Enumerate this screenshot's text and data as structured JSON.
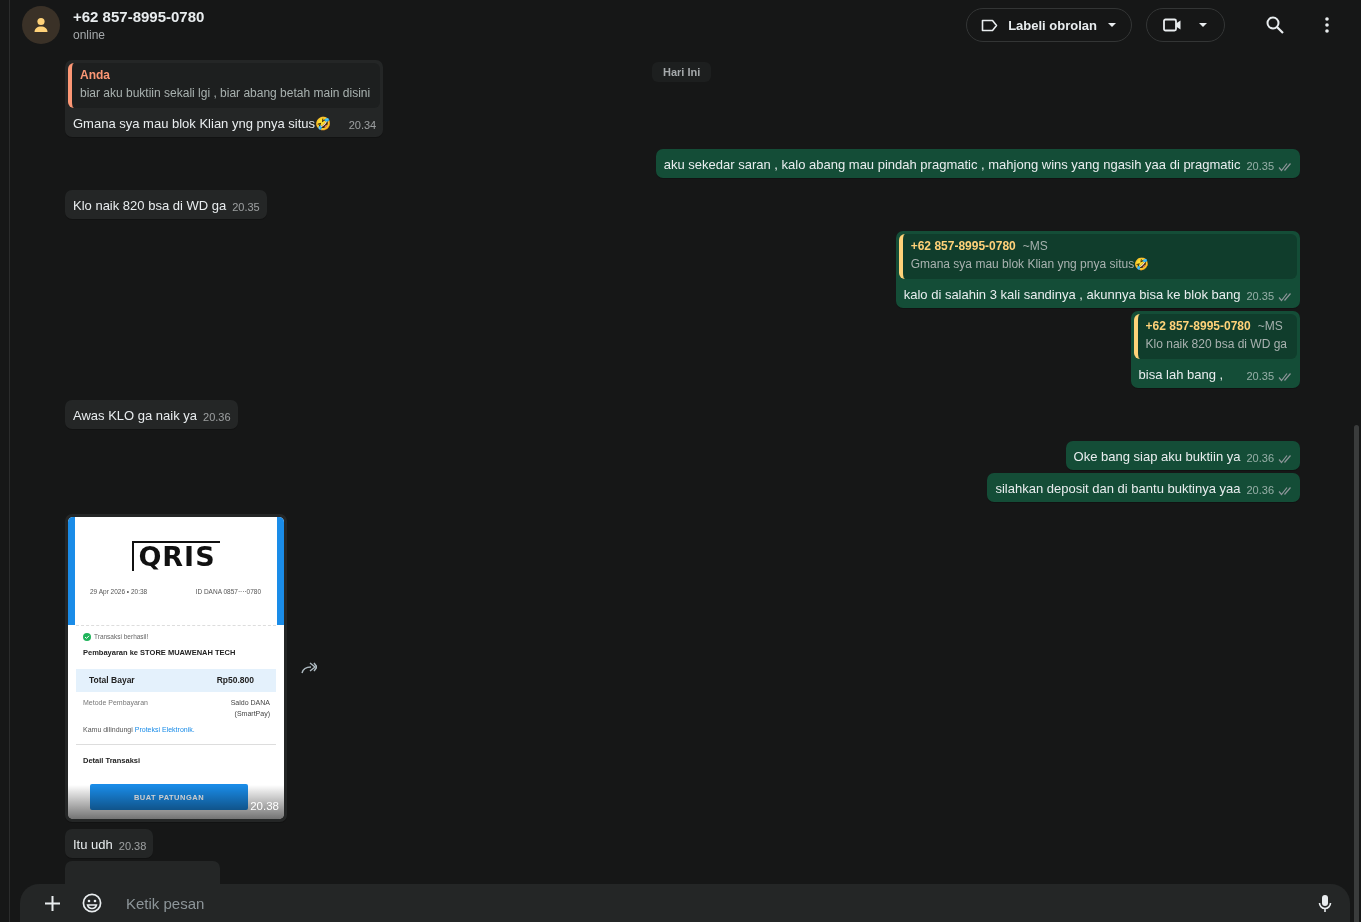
{
  "header": {
    "name": "+62 857-8995-0780",
    "status": "online",
    "label_button": "Labeli obrolan"
  },
  "date_chip": "Hari Ini",
  "messages": [
    {
      "kind": "text",
      "outgoing": false,
      "quote": {
        "author": "Anda",
        "own": true,
        "text": "biar aku buktiin sekali lgi , biar abang betah main disini"
      },
      "text": "Gmana sya mau blok Klian yng pnya situs🤣",
      "time": "20.34"
    },
    {
      "kind": "text",
      "outgoing": true,
      "text": "aku sekedar saran , kalo abang mau pindah pragmatic , mahjong wins yang ngasih yaa di pragmatic",
      "time": "20.35",
      "delivered": true
    },
    {
      "kind": "text",
      "outgoing": false,
      "text": "Klo naik 820 bsa di WD ga",
      "time": "20.35"
    },
    {
      "kind": "text",
      "outgoing": true,
      "quote": {
        "author": "+62 857-8995-0780",
        "own": false,
        "push_name": "~MS",
        "text": "Gmana sya mau blok Klian yng pnya situs🤣"
      },
      "text": "kalo di salahin 3 kali sandinya , akunnya bisa ke blok bang",
      "time": "20.35",
      "delivered": true
    },
    {
      "kind": "text",
      "outgoing": true,
      "quote": {
        "author": "+62 857-8995-0780",
        "own": false,
        "push_name": "~MS",
        "text": "Klo naik 820 bsa di WD ga"
      },
      "text": "bisa lah bang ,",
      "time": "20.35",
      "delivered": true
    },
    {
      "kind": "text",
      "outgoing": false,
      "text": "Awas KLO ga naik ya",
      "time": "20.36"
    },
    {
      "kind": "text",
      "outgoing": true,
      "text": "Oke bang siap aku buktiin ya",
      "time": "20.36",
      "delivered": true
    },
    {
      "kind": "text",
      "outgoing": true,
      "text": "silahkan deposit dan di bantu buktinya yaa",
      "time": "20.36",
      "delivered": true
    },
    {
      "kind": "receipt",
      "outgoing": false,
      "time": "20.38",
      "receipt": {
        "logo": "QRIS",
        "date": "29 Apr 2026 • 20:38",
        "account": "ID DANA 0857····0780",
        "result": "Transaksi berhasil!",
        "merchant": "Pembayaran ke STORE MUAWENAH TECH",
        "total_label": "Total Bayar",
        "total": "Rp50.800",
        "method_label": "Metode Pembayaran",
        "method": [
          "Saldo DANA",
          "(SmartPay)"
        ],
        "protection": "Kamu dilindungi",
        "protection_link": "Proteksi Elektronik.",
        "detail": "Detail Transaksi",
        "button": "BUAT PATUNGAN"
      }
    },
    {
      "kind": "text",
      "outgoing": false,
      "text": "Itu udh",
      "time": "20.38"
    },
    {
      "kind": "covered",
      "outgoing": false
    }
  ],
  "composer": {
    "placeholder": "Ketik pesan"
  }
}
